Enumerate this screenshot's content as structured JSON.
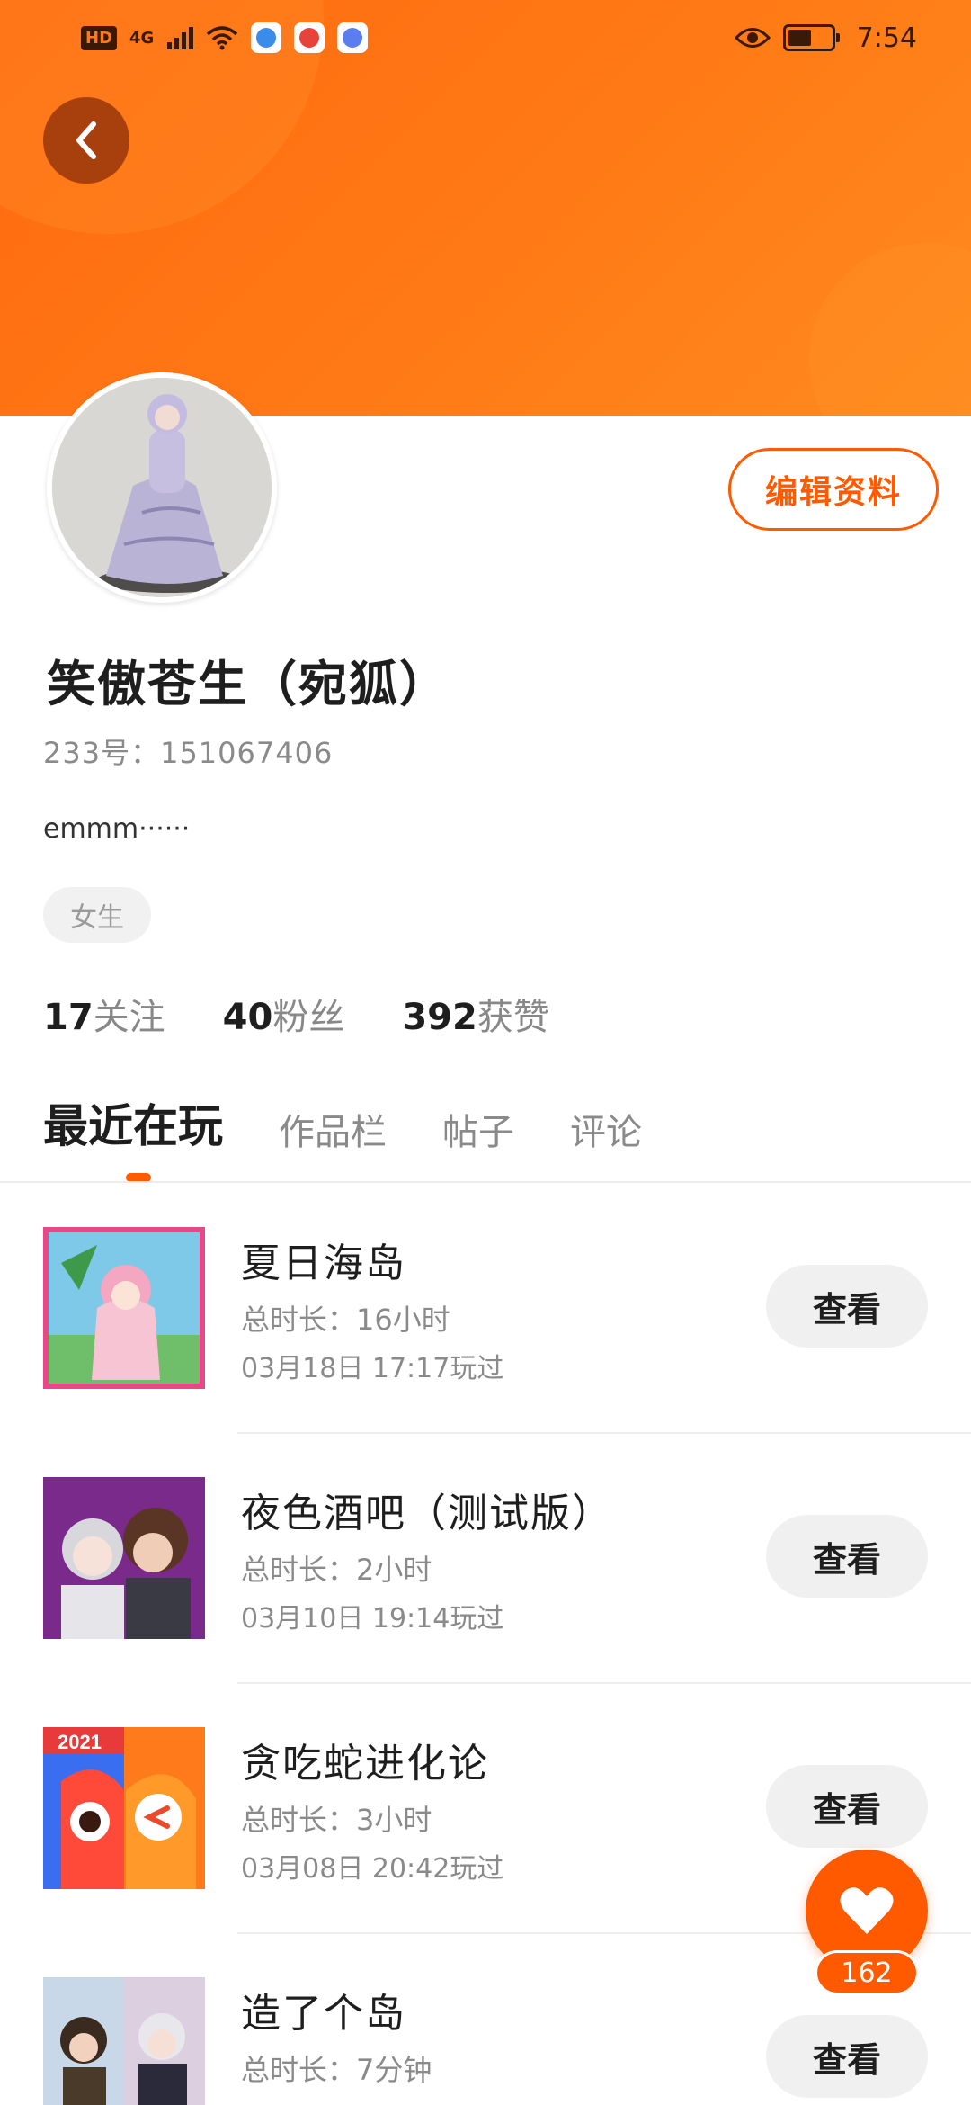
{
  "status_bar": {
    "left_badge": "HD",
    "network": "4G",
    "time": "7:54"
  },
  "profile": {
    "edit_button": "编辑资料",
    "name": "笑傲苍生（宛狐）",
    "uid": "233号：151067406",
    "bio": "emmm······",
    "gender": "女生",
    "stats": [
      {
        "num": "17",
        "label": "关注"
      },
      {
        "num": "40",
        "label": "粉丝"
      },
      {
        "num": "392",
        "label": "获赞"
      }
    ]
  },
  "tabs": [
    "最近在玩",
    "作品栏",
    "帖子",
    "评论"
  ],
  "games": [
    {
      "title": "夏日海岛",
      "duration": "总时长：16小时",
      "last_played": "03月18日 17:17玩过",
      "view": "查看"
    },
    {
      "title": "夜色酒吧（测试版）",
      "duration": "总时长：2小时",
      "last_played": "03月10日 19:14玩过",
      "view": "查看"
    },
    {
      "title": "贪吃蛇进化论",
      "duration": "总时长：3小时",
      "last_played": "03月08日 20:42玩过",
      "view": "查看",
      "thumb_badge": "2021"
    },
    {
      "title": "造了个岛",
      "duration": "总时长：7分钟",
      "last_played": "",
      "view": "查看"
    }
  ],
  "like": {
    "count": "162"
  },
  "colors": {
    "accent": "#ff5a00",
    "banner": "#ff7a16"
  }
}
